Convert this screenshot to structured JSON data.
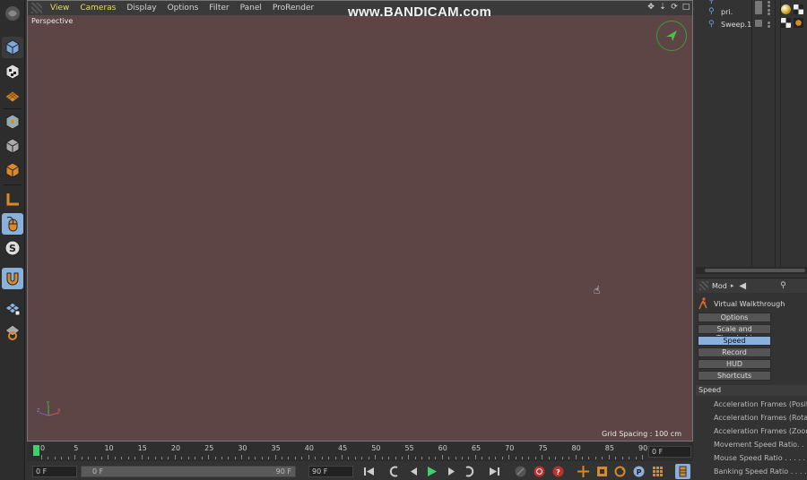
{
  "viewport": {
    "menus": [
      "View",
      "Cameras",
      "Display",
      "Options",
      "Filter",
      "Panel",
      "ProRender"
    ],
    "label": "Perspective",
    "grid_spacing": "Grid Spacing : 100 cm",
    "watermark": "www.BANDICAM.com"
  },
  "left_toolbar": {
    "tools": [
      "cube-icon",
      "checker-cube-icon",
      "grid-plane-icon",
      "model-mode-icon",
      "object-mode-icon",
      "polygon-mode-icon",
      "axis-l-icon",
      "mouse-icon",
      "snap-s-icon",
      "magnet-icon",
      "workplane-lock-icon",
      "workplane-icon"
    ]
  },
  "object_manager": {
    "objects": [
      {
        "name": "",
        "icon": "object-icon"
      },
      {
        "name": "pri.",
        "icon": "primitive-icon"
      },
      {
        "name": "Sweep.1",
        "icon": "sweep-icon"
      }
    ]
  },
  "attribute_manager": {
    "mode_label": "Mod",
    "tool_name": "Virtual Walkthrough",
    "tabs": [
      "Options",
      "Scale and Threshold",
      "Speed",
      "Record",
      "HUD",
      "Shortcuts"
    ],
    "active_tab": "Speed",
    "section": "Speed",
    "params": [
      "Acceleration Frames (Positio",
      "Acceleration Frames (Rotati",
      "Acceleration Frames (Zoom)",
      "Movement Speed Ratio. . . . .",
      "Mouse Speed Ratio . . . . . .",
      "Banking Speed Ratio . . . . ."
    ]
  },
  "timeline": {
    "ticks": [
      "0",
      "5",
      "10",
      "15",
      "20",
      "25",
      "30",
      "35",
      "40",
      "45",
      "50",
      "55",
      "60",
      "65",
      "70",
      "75",
      "80",
      "85",
      "90"
    ],
    "current_frame": "0 F"
  },
  "transport": {
    "start_frame": "0 F",
    "range_start": "0 F",
    "range_end": "90 F",
    "end_frame": "90 F"
  },
  "colors": {
    "viewport_bg": "#5e4545",
    "accent_menu": "#e6dd66",
    "active_tab": "#8ab0dc",
    "playhead": "#3fd06a"
  }
}
